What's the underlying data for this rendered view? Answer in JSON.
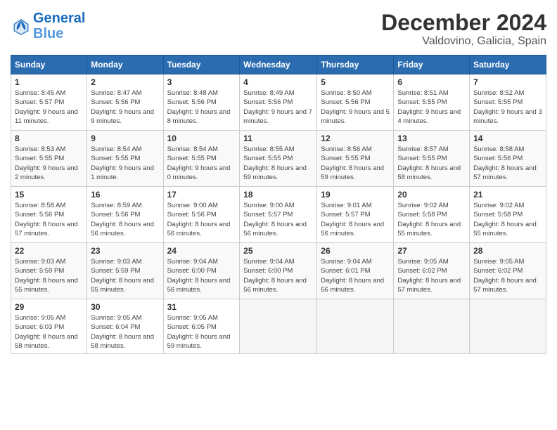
{
  "header": {
    "logo_line1": "General",
    "logo_line2": "Blue",
    "month": "December 2024",
    "location": "Valdovino, Galicia, Spain"
  },
  "days_of_week": [
    "Sunday",
    "Monday",
    "Tuesday",
    "Wednesday",
    "Thursday",
    "Friday",
    "Saturday"
  ],
  "weeks": [
    [
      {
        "day": "1",
        "info": "Sunrise: 8:45 AM\nSunset: 5:57 PM\nDaylight: 9 hours and 11 minutes."
      },
      {
        "day": "2",
        "info": "Sunrise: 8:47 AM\nSunset: 5:56 PM\nDaylight: 9 hours and 9 minutes."
      },
      {
        "day": "3",
        "info": "Sunrise: 8:48 AM\nSunset: 5:56 PM\nDaylight: 9 hours and 8 minutes."
      },
      {
        "day": "4",
        "info": "Sunrise: 8:49 AM\nSunset: 5:56 PM\nDaylight: 9 hours and 7 minutes."
      },
      {
        "day": "5",
        "info": "Sunrise: 8:50 AM\nSunset: 5:56 PM\nDaylight: 9 hours and 5 minutes."
      },
      {
        "day": "6",
        "info": "Sunrise: 8:51 AM\nSunset: 5:55 PM\nDaylight: 9 hours and 4 minutes."
      },
      {
        "day": "7",
        "info": "Sunrise: 8:52 AM\nSunset: 5:55 PM\nDaylight: 9 hours and 3 minutes."
      }
    ],
    [
      {
        "day": "8",
        "info": "Sunrise: 8:53 AM\nSunset: 5:55 PM\nDaylight: 9 hours and 2 minutes."
      },
      {
        "day": "9",
        "info": "Sunrise: 8:54 AM\nSunset: 5:55 PM\nDaylight: 9 hours and 1 minute."
      },
      {
        "day": "10",
        "info": "Sunrise: 8:54 AM\nSunset: 5:55 PM\nDaylight: 9 hours and 0 minutes."
      },
      {
        "day": "11",
        "info": "Sunrise: 8:55 AM\nSunset: 5:55 PM\nDaylight: 8 hours and 59 minutes."
      },
      {
        "day": "12",
        "info": "Sunrise: 8:56 AM\nSunset: 5:55 PM\nDaylight: 8 hours and 59 minutes."
      },
      {
        "day": "13",
        "info": "Sunrise: 8:57 AM\nSunset: 5:55 PM\nDaylight: 8 hours and 58 minutes."
      },
      {
        "day": "14",
        "info": "Sunrise: 8:58 AM\nSunset: 5:56 PM\nDaylight: 8 hours and 57 minutes."
      }
    ],
    [
      {
        "day": "15",
        "info": "Sunrise: 8:58 AM\nSunset: 5:56 PM\nDaylight: 8 hours and 57 minutes."
      },
      {
        "day": "16",
        "info": "Sunrise: 8:59 AM\nSunset: 5:56 PM\nDaylight: 8 hours and 56 minutes."
      },
      {
        "day": "17",
        "info": "Sunrise: 9:00 AM\nSunset: 5:56 PM\nDaylight: 8 hours and 56 minutes."
      },
      {
        "day": "18",
        "info": "Sunrise: 9:00 AM\nSunset: 5:57 PM\nDaylight: 8 hours and 56 minutes."
      },
      {
        "day": "19",
        "info": "Sunrise: 9:01 AM\nSunset: 5:57 PM\nDaylight: 8 hours and 56 minutes."
      },
      {
        "day": "20",
        "info": "Sunrise: 9:02 AM\nSunset: 5:58 PM\nDaylight: 8 hours and 55 minutes."
      },
      {
        "day": "21",
        "info": "Sunrise: 9:02 AM\nSunset: 5:58 PM\nDaylight: 8 hours and 55 minutes."
      }
    ],
    [
      {
        "day": "22",
        "info": "Sunrise: 9:03 AM\nSunset: 5:59 PM\nDaylight: 8 hours and 55 minutes."
      },
      {
        "day": "23",
        "info": "Sunrise: 9:03 AM\nSunset: 5:59 PM\nDaylight: 8 hours and 55 minutes."
      },
      {
        "day": "24",
        "info": "Sunrise: 9:04 AM\nSunset: 6:00 PM\nDaylight: 8 hours and 56 minutes."
      },
      {
        "day": "25",
        "info": "Sunrise: 9:04 AM\nSunset: 6:00 PM\nDaylight: 8 hours and 56 minutes."
      },
      {
        "day": "26",
        "info": "Sunrise: 9:04 AM\nSunset: 6:01 PM\nDaylight: 8 hours and 56 minutes."
      },
      {
        "day": "27",
        "info": "Sunrise: 9:05 AM\nSunset: 6:02 PM\nDaylight: 8 hours and 57 minutes."
      },
      {
        "day": "28",
        "info": "Sunrise: 9:05 AM\nSunset: 6:02 PM\nDaylight: 8 hours and 57 minutes."
      }
    ],
    [
      {
        "day": "29",
        "info": "Sunrise: 9:05 AM\nSunset: 6:03 PM\nDaylight: 8 hours and 58 minutes."
      },
      {
        "day": "30",
        "info": "Sunrise: 9:05 AM\nSunset: 6:04 PM\nDaylight: 8 hours and 58 minutes."
      },
      {
        "day": "31",
        "info": "Sunrise: 9:05 AM\nSunset: 6:05 PM\nDaylight: 8 hours and 59 minutes."
      },
      null,
      null,
      null,
      null
    ]
  ]
}
